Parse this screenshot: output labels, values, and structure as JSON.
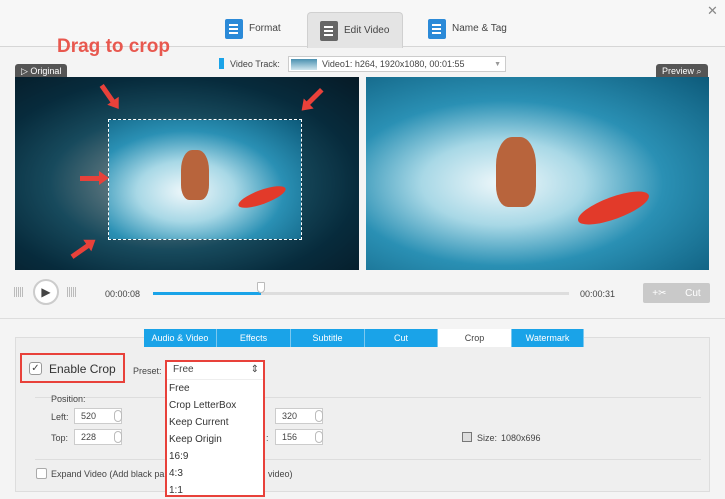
{
  "header": {
    "tabs": [
      {
        "label": "Format"
      },
      {
        "label": "Edit Video"
      },
      {
        "label": "Name & Tag"
      }
    ],
    "close": "✕"
  },
  "annotation": "Drag to crop",
  "video_track": {
    "label": "Video Track:",
    "value": "Video1: h264, 1920x1080, 00:01:55"
  },
  "panes": {
    "original": "Original",
    "preview": "Preview"
  },
  "player": {
    "current_time": "00:00:08",
    "end_time": "00:00:31",
    "progress": 0.26,
    "cut_label": "Cut"
  },
  "edit_tabs": [
    {
      "label": "Audio & Video"
    },
    {
      "label": "Effects"
    },
    {
      "label": "Subtitle"
    },
    {
      "label": "Cut"
    },
    {
      "label": "Crop"
    },
    {
      "label": "Watermark"
    }
  ],
  "crop": {
    "enable_label": "Enable Crop",
    "enabled": true,
    "preset_label": "Preset:",
    "preset_value": "Free",
    "preset_options": [
      "Free",
      "Crop LetterBox",
      "Keep Current",
      "Keep Origin",
      "16:9",
      "4:3",
      "1:1"
    ],
    "position_label": "Position:",
    "left_label": "Left:",
    "left": "520",
    "top_label": "Top:",
    "top": "228",
    "width": "320",
    "height_suffix": ":",
    "height": "156",
    "size_label": "Size:",
    "size": "1080x696",
    "expand_label_start": "Expand Video (Add black pa",
    "expand_label_end": "video)"
  }
}
